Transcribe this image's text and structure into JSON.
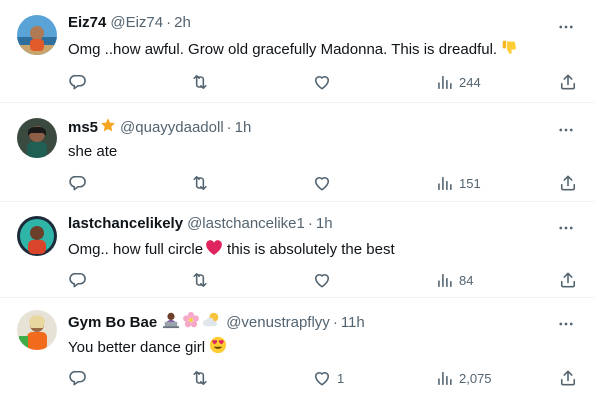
{
  "tweets": [
    {
      "name": "Eiz74",
      "handle": "@Eiz74",
      "time": "2h",
      "text": "Omg ..how awful. Grow old gracefully Madonna. This is dreadful.",
      "trailing_emoji": "thumbs-down",
      "likes": "",
      "views": "244"
    },
    {
      "name": "ms5",
      "name_emoji": "star",
      "handle": "@quayydaadoll",
      "time": "1h",
      "text": "she ate",
      "likes": "",
      "views": "151"
    },
    {
      "name": "lastchancelikely",
      "handle": "@lastchancelike1",
      "time": "1h",
      "text_before": "Omg.. how full circle",
      "inline_emoji": "red-heart",
      "text_after": "this is absolutely the best",
      "likes": "",
      "views": "84"
    },
    {
      "name": "Gym Bo Bae",
      "name_emojis": [
        "person-at-laptop",
        "blossom",
        "sun-behind-cloud"
      ],
      "handle": "@venustrapflyy",
      "time": "11h",
      "text": "You better dance girl",
      "trailing_emoji": "smiling-face-with-heart-eyes",
      "likes": "1",
      "views": "2,075"
    }
  ],
  "separator": "·",
  "icons": [
    "reply-icon",
    "retweet-icon",
    "like-icon",
    "views-icon",
    "share-icon",
    "more-icon"
  ],
  "colors": {
    "text": "#0f1419",
    "secondary": "#536471",
    "divider": "#eff3f4",
    "heart": "#e0245e",
    "star": "#f4a623"
  }
}
